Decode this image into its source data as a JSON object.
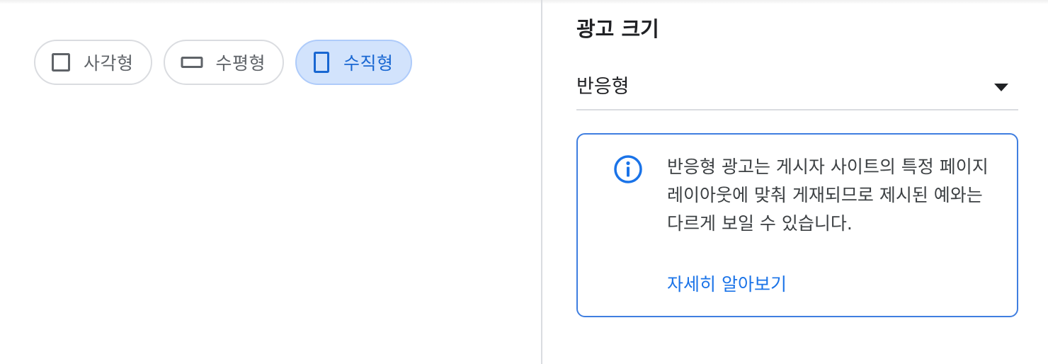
{
  "ad_shape": {
    "options": [
      {
        "label": "사각형",
        "icon": "square-outline-icon",
        "selected": false
      },
      {
        "label": "수평형",
        "icon": "horizontal-rectangle-icon",
        "selected": false
      },
      {
        "label": "수직형",
        "icon": "vertical-rectangle-icon",
        "selected": true
      }
    ]
  },
  "ad_size": {
    "title": "광고 크기",
    "selected_value": "반응형",
    "info": {
      "icon": "info-icon",
      "text": "반응형 광고는 게시자 사이트의 특정 페이지 레이아웃에 맞춰 게재되므로 제시된 예와는 다르게 보일 수 있습니다.",
      "link_label": "자세히 알아보기"
    }
  },
  "colors": {
    "accent": "#1a73e8",
    "selected_chip_bg": "#d2e3fc",
    "border": "#dadce0"
  }
}
